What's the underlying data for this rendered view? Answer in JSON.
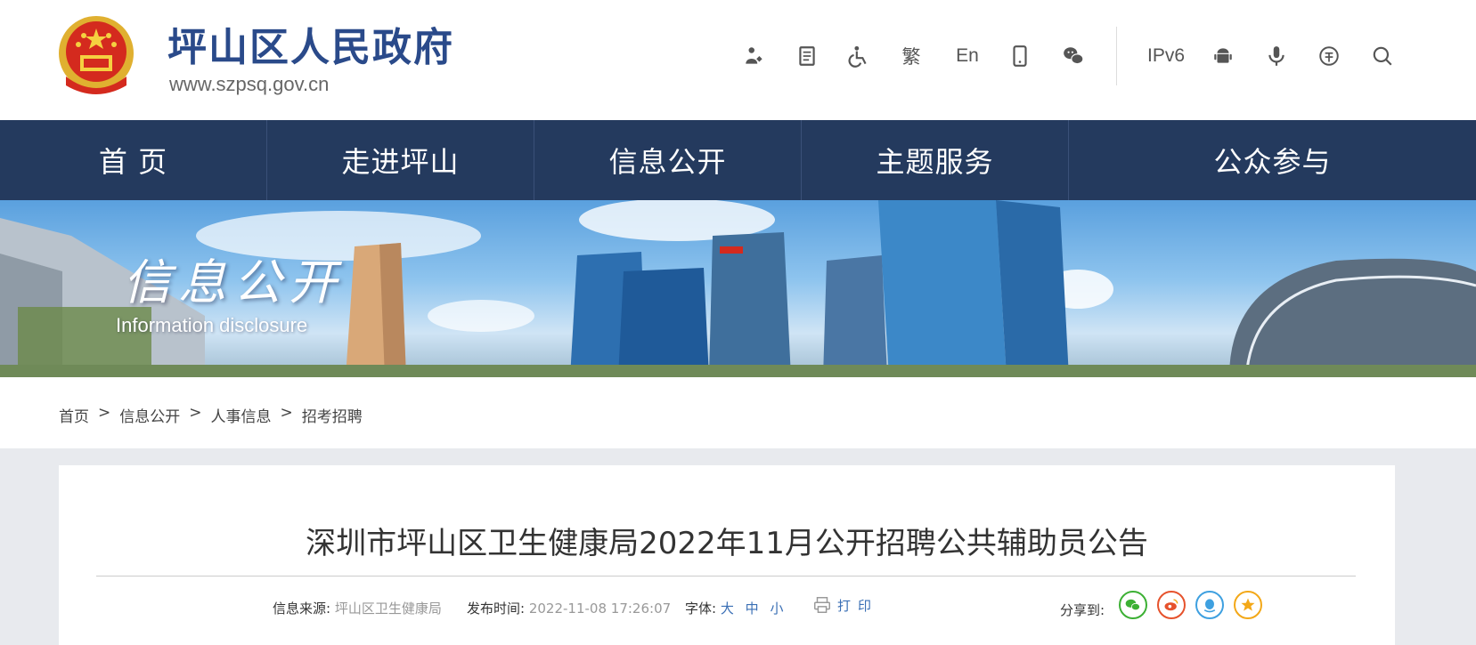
{
  "header": {
    "site_title": "坪山区人民政府",
    "site_url": "www.szpsq.gov.cn",
    "tools": {
      "traditional": "繁",
      "english": "En",
      "ipv6": "IPv6"
    }
  },
  "nav": {
    "items": [
      "首 页",
      "走进坪山",
      "信息公开",
      "主题服务",
      "公众参与"
    ]
  },
  "banner": {
    "title": "信息公开",
    "subtitle": "Information disclosure"
  },
  "breadcrumb": {
    "items": [
      "首页",
      "信息公开",
      "人事信息",
      "招考招聘"
    ],
    "separator": ">"
  },
  "article": {
    "title": "深圳市坪山区卫生健康局2022年11月公开招聘公共辅助员公告",
    "source_label": "信息来源:",
    "source_value": "坪山区卫生健康局",
    "time_label": "发布时间:",
    "time_value": "2022-11-08 17:26:07",
    "font_label": "字体:",
    "font_large": "大",
    "font_medium": "中",
    "font_small": "小",
    "print_label": "打印",
    "share_label": "分享到:"
  },
  "colors": {
    "nav_bg": "#243a5e",
    "title_blue": "#2a4a8a",
    "wechat": "#3cb034",
    "weibo": "#e6522c",
    "qq": "#3ea0e0",
    "qzone": "#f3a818"
  }
}
